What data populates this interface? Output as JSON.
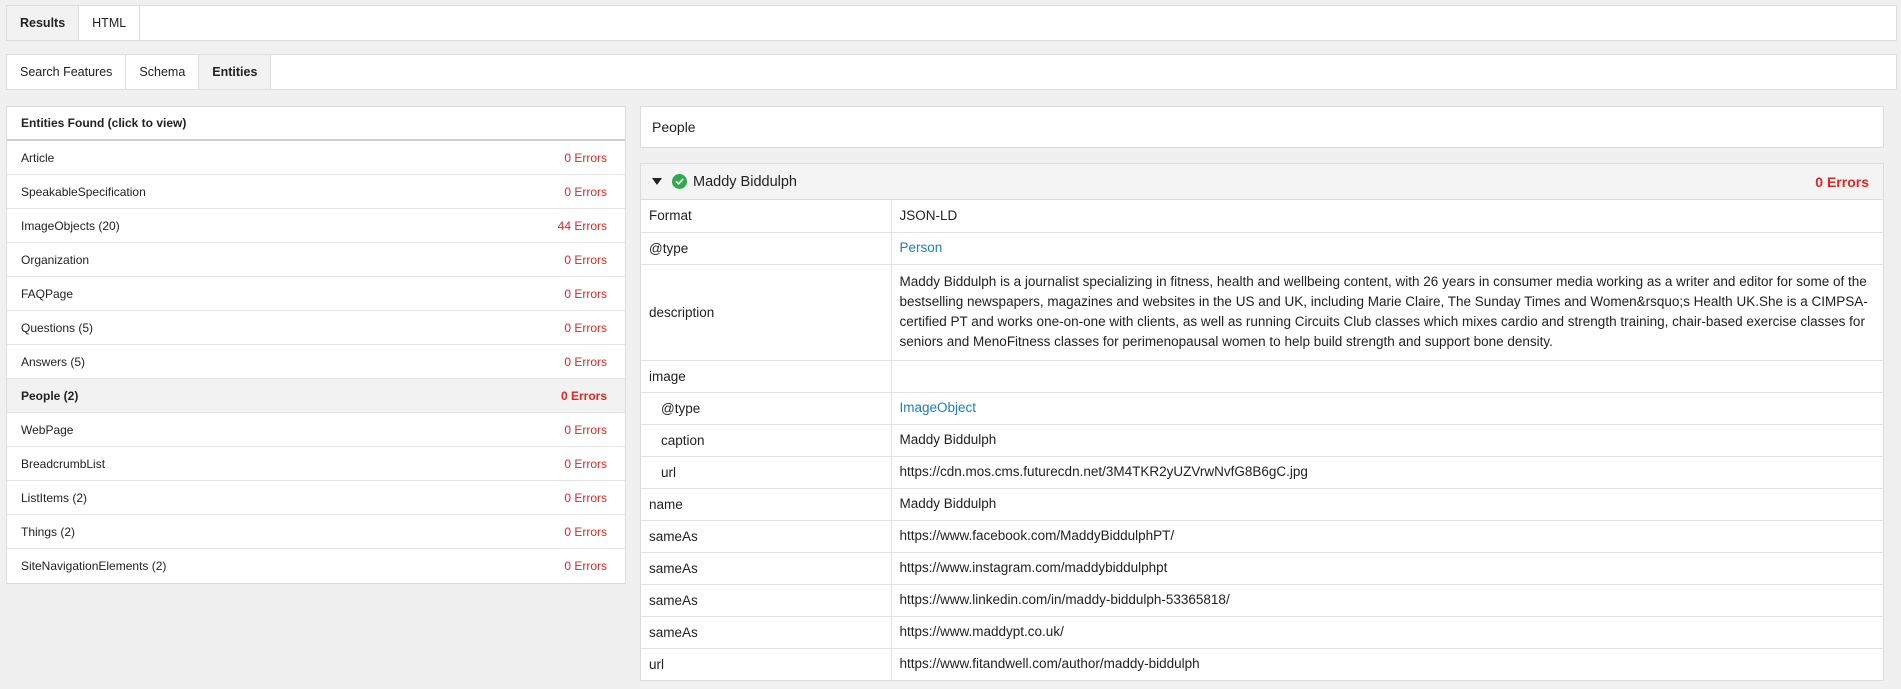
{
  "top_tabs": [
    "Results",
    "HTML"
  ],
  "sub_tabs": [
    "Search Features",
    "Schema",
    "Entities"
  ],
  "entities": {
    "header": "Entities Found (click to view)",
    "items": [
      {
        "label": "Article",
        "errors": "0 Errors"
      },
      {
        "label": "SpeakableSpecification",
        "errors": "0 Errors"
      },
      {
        "label": "ImageObjects (20)",
        "errors": "44 Errors"
      },
      {
        "label": "Organization",
        "errors": "0 Errors"
      },
      {
        "label": "FAQPage",
        "errors": "0 Errors"
      },
      {
        "label": "Questions (5)",
        "errors": "0 Errors"
      },
      {
        "label": "Answers (5)",
        "errors": "0 Errors"
      },
      {
        "label": "People (2)",
        "errors": "0 Errors"
      },
      {
        "label": "WebPage",
        "errors": "0 Errors"
      },
      {
        "label": "BreadcrumbList",
        "errors": "0 Errors"
      },
      {
        "label": "ListItems (2)",
        "errors": "0 Errors"
      },
      {
        "label": "Things (2)",
        "errors": "0 Errors"
      },
      {
        "label": "SiteNavigationElements (2)",
        "errors": "0 Errors"
      }
    ]
  },
  "detail": {
    "section_title": "People",
    "entity_name": "Maddy Biddulph",
    "errors": "0 Errors",
    "rows": [
      {
        "key": "Format",
        "value": "JSON-LD"
      },
      {
        "key": "@type",
        "value": "Person"
      },
      {
        "key": "description",
        "value": "Maddy Biddulph is a journalist specializing in fitness, health and wellbeing content, with 26 years in consumer media working as a writer and editor for some of the bestselling newspapers, magazines and websites in the US and UK, including Marie Claire, The Sunday Times and Women&rsquo;s Health UK.She is a CIMPSA-certified PT and works one-on-one with clients, as well as running Circuits Club classes which mixes cardio and strength training, chair-based exercise classes for seniors and MenoFitness classes for perimenopausal women to help build strength and support bone density."
      },
      {
        "key": "image",
        "value": ""
      },
      {
        "key": "@type",
        "value": "ImageObject"
      },
      {
        "key": "caption",
        "value": "Maddy Biddulph"
      },
      {
        "key": "url",
        "value": "https://cdn.mos.cms.futurecdn.net/3M4TKR2yUZVrwNvfG8B6gC.jpg"
      },
      {
        "key": "name",
        "value": "Maddy Biddulph"
      },
      {
        "key": "sameAs",
        "value": "https://www.facebook.com/MaddyBiddulphPT/"
      },
      {
        "key": "sameAs",
        "value": "https://www.instagram.com/maddybiddulphpt"
      },
      {
        "key": "sameAs",
        "value": "https://www.linkedin.com/in/maddy-biddulph-53365818/"
      },
      {
        "key": "sameAs",
        "value": "https://www.maddypt.co.uk/"
      },
      {
        "key": "url",
        "value": "https://www.fitandwell.com/author/maddy-biddulph"
      }
    ]
  },
  "colors": {
    "error": "#e0261f",
    "link": "#1a7ec0",
    "check": "#2eaa4a"
  },
  "icons": [
    "caret-down-icon",
    "check-circle-icon"
  ]
}
